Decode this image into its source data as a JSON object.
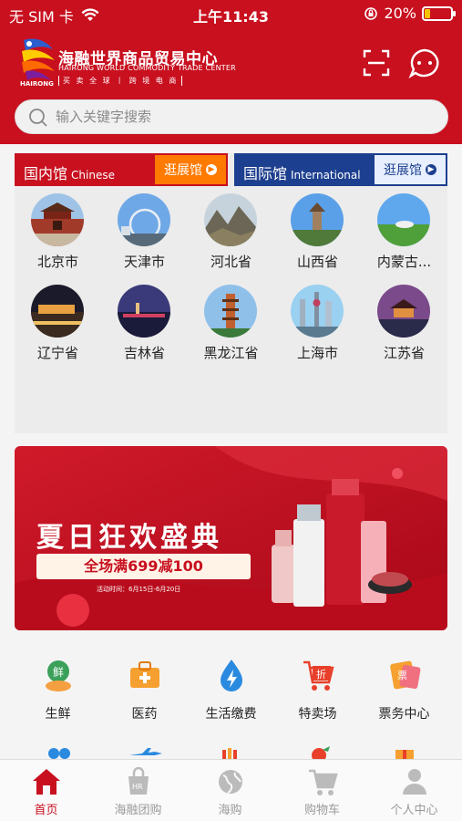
{
  "status_bar": {
    "carrier": "无 SIM 卡",
    "time": "上午11:43",
    "battery": "20%",
    "battery_level": 0.2
  },
  "brand": {
    "logo_text": "HAIRONG",
    "name_cn": "海融世界商品贸易中心",
    "name_en": "HAIRONG WORLD COMMODITY TRADE CENTER",
    "tagline": "买 卖 全 球 丨 跨 境 电 商"
  },
  "search": {
    "placeholder": "输入关键字搜索"
  },
  "pavilions": {
    "domestic": {
      "title": "国内馆",
      "subtitle": "Chinese",
      "visit_label": "逛展馆"
    },
    "international": {
      "title": "国际馆",
      "subtitle": "International",
      "visit_label": "逛展馆"
    },
    "cities": [
      {
        "label": "北京市"
      },
      {
        "label": "天津市"
      },
      {
        "label": "河北省"
      },
      {
        "label": "山西省"
      },
      {
        "label": "内蒙古..."
      },
      {
        "label": "辽宁省"
      },
      {
        "label": "吉林省"
      },
      {
        "label": "黑龙江省"
      },
      {
        "label": "上海市"
      },
      {
        "label": "江苏省"
      }
    ]
  },
  "banner": {
    "title": "夏日狂欢盛典",
    "promo": "全场满699减100",
    "time": "活动时间：6月15日-6月20日",
    "colors": {
      "primary": "#c8101f",
      "accent": "#e83040"
    }
  },
  "quick_menu": {
    "items": [
      {
        "label": "生鲜",
        "icon": "fresh-produce-icon",
        "badge": "鲜"
      },
      {
        "label": "医药",
        "icon": "medicine-kit-icon"
      },
      {
        "label": "生活缴费",
        "icon": "utility-payment-icon"
      },
      {
        "label": "特卖场",
        "icon": "sale-cart-icon",
        "badge": "折"
      },
      {
        "label": "票务中心",
        "icon": "ticket-icon",
        "badge": "票"
      }
    ]
  },
  "tab_bar": {
    "items": [
      {
        "label": "首页",
        "icon": "home-icon",
        "active": true
      },
      {
        "label": "海融团购",
        "icon": "group-buy-icon"
      },
      {
        "label": "海购",
        "icon": "globe-icon"
      },
      {
        "label": "购物车",
        "icon": "cart-icon"
      },
      {
        "label": "个人中心",
        "icon": "profile-icon"
      }
    ]
  },
  "colors": {
    "brand_red": "#c8101f",
    "international_blue": "#1d3f8f",
    "visit_orange": "#ff7a00"
  }
}
